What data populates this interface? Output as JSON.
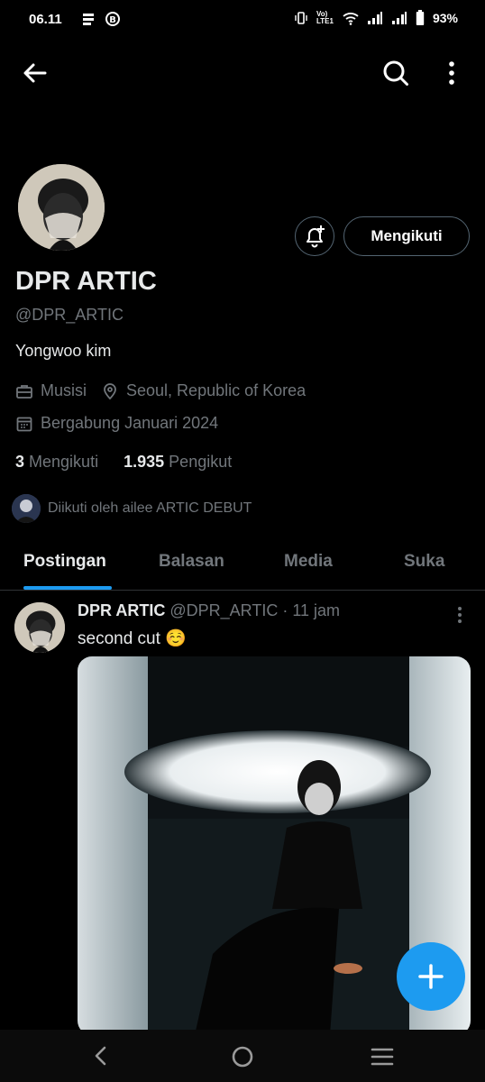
{
  "status_bar": {
    "time": "06.11",
    "battery": "93%",
    "volte": "Vo) LTE1"
  },
  "profile": {
    "name": "DPR ARTIC",
    "handle": "@DPR_ARTIC",
    "bio": "Yongwoo kim",
    "category": "Musisi",
    "location": "Seoul, Republic of Korea",
    "joined": "Bergabung Januari 2024",
    "following_count": "3",
    "following_label": "Mengikuti",
    "followers_count": "1.935",
    "followers_label": "Pengikut",
    "followed_by": "Diikuti oleh ailee ARTIC DEBUT",
    "follow_button": "Mengikuti"
  },
  "tabs": [
    {
      "label": "Postingan",
      "active": true
    },
    {
      "label": "Balasan",
      "active": false
    },
    {
      "label": "Media",
      "active": false
    },
    {
      "label": "Suka",
      "active": false
    }
  ],
  "post": {
    "name": "DPR ARTIC",
    "handle": "@DPR_ARTIC",
    "separator": " · ",
    "time": "11 jam",
    "text": "second cut ☺️"
  },
  "colors": {
    "accent": "#1d9bf0",
    "background": "#000000",
    "muted": "#71767b",
    "text": "#e7e9ea"
  },
  "icons": [
    "back-arrow-icon",
    "search-icon",
    "more-vertical-icon",
    "bell-plus-icon",
    "briefcase-icon",
    "location-pin-icon",
    "calendar-icon",
    "plus-icon",
    "nav-back-icon",
    "nav-home-icon",
    "nav-recents-icon"
  ]
}
